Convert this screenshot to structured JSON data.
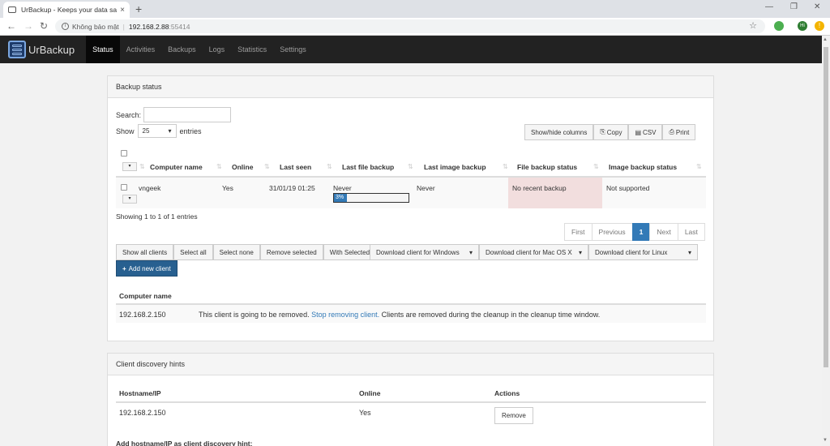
{
  "browser": {
    "tab_title": "UrBackup - Keeps your data safe",
    "tab_close": "×",
    "new_tab": "+",
    "insecure_label": "Không bảo mật",
    "url_host": "192.168.2.88",
    "url_port": ":55414",
    "profile_badge": "Hi",
    "alert_badge": "!"
  },
  "appnav": {
    "brand": "UrBackup",
    "items": [
      "Status",
      "Activities",
      "Backups",
      "Logs",
      "Statistics",
      "Settings"
    ],
    "active": "Status"
  },
  "backup_panel": {
    "title": "Backup status",
    "search_label": "Search:",
    "search_value": "",
    "show_label": "Show",
    "show_value": "25",
    "entries_label": "entries",
    "export_buttons": [
      "Show/hide columns",
      "Copy",
      "CSV",
      "Print"
    ],
    "columns": [
      "Computer name",
      "Online",
      "Last seen",
      "Last file backup",
      "Last image backup",
      "File backup status",
      "Image backup status"
    ],
    "rows": [
      {
        "computer_name": "vngeek",
        "online": "Yes",
        "last_seen": "31/01/19 01:25",
        "last_file_backup": "Never",
        "progress_label": "3%",
        "progress": 0.03,
        "last_image_backup": "Never",
        "file_backup_status": "No recent backup",
        "image_backup_status": "Not supported"
      }
    ],
    "info": "Showing 1 to 1 of 1 entries",
    "pagination": [
      "First",
      "Previous",
      "1",
      "Next",
      "Last"
    ],
    "active_page": "1",
    "action_buttons": [
      "Show all clients",
      "Select all",
      "Select none",
      "Remove selected",
      "With Selected"
    ],
    "download_buttons": [
      "Download client for Windows",
      "Download client for Mac OS X",
      "Download client for Linux"
    ],
    "add_client": "Add new client",
    "removal_header": "Computer name",
    "removal_row": {
      "ip": "192.168.2.150",
      "text_before": "This client is going to be removed. ",
      "link": "Stop removing client.",
      "text_after": " Clients are removed during the cleanup in the cleanup time window."
    }
  },
  "hints_panel": {
    "title": "Client discovery hints",
    "columns": [
      "Hostname/IP",
      "Online",
      "Actions"
    ],
    "row": {
      "host": "192.168.2.150",
      "online": "Yes",
      "action": "Remove"
    },
    "add_label": "Add hostname/IP as client discovery hint:"
  },
  "colors": {
    "navbar": "#222222",
    "primary": "#337ab7",
    "danger_bg": "#f2dede"
  }
}
